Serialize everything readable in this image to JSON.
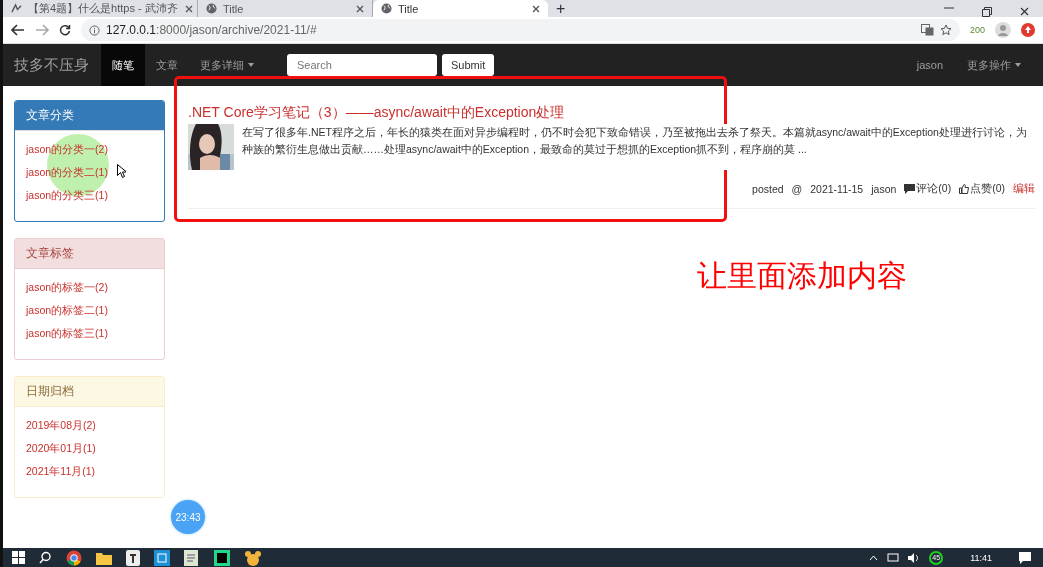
{
  "browser": {
    "tabs": [
      {
        "title": "【第4题】什么是https - 武沛齐",
        "selected": false
      },
      {
        "title": "Title",
        "selected": false
      },
      {
        "title": "Title",
        "selected": true
      }
    ],
    "new_tab": "+",
    "url_host": "127.0.0.1",
    "url_rest": ":8000/jason/archive/2021-11/#",
    "extension_badge": "200"
  },
  "navbar": {
    "brand": "技多不压身",
    "items": [
      {
        "label": "随笔",
        "selected": true,
        "dropdown": false
      },
      {
        "label": "文章",
        "selected": false,
        "dropdown": false
      },
      {
        "label": "更多详细",
        "selected": false,
        "dropdown": true
      }
    ],
    "search": {
      "placeholder": "Search"
    },
    "submit": "Submit",
    "user": "jason",
    "more": "更多操作"
  },
  "sidebar": [
    {
      "kind": "primary",
      "title": "文章分类",
      "items": [
        "jason的分类一(2)",
        "jason的分类二(1)",
        "jason的分类三(1)"
      ]
    },
    {
      "kind": "danger",
      "title": "文章标签",
      "items": [
        "jason的标签一(2)",
        "jason的标签二(1)",
        "jason的标签三(1)"
      ]
    },
    {
      "kind": "warning",
      "title": "日期归档",
      "items": [
        "2019年08月(2)",
        "2020年01月(1)",
        "2021年11月(1)"
      ]
    }
  ],
  "articles": [
    {
      "title": ".NET Core学习笔记（3）——async/await中的Exception处理",
      "summary": "在写了很多年.NET程序之后，年长的猿类在面对异步编程时，仍不时会犯下致命错误，乃至被拖出去杀了祭天。本篇就async/await中的Exception处理进行讨论，为种族的繁衍生息做出贡献……处理async/await中的Exception，最致命的莫过于想抓的Exception抓不到，程序崩的莫 ...",
      "posted": "posted",
      "at": "@",
      "date": "2021-11-15",
      "author": "jason",
      "comments": "评论(0)",
      "likes": "点赞(0)",
      "edit": "编辑"
    }
  ],
  "annotation": {
    "text": "让里面添加内容"
  },
  "timer": "23:43",
  "taskbar": {
    "tray_badge": "45",
    "time": "11:41"
  }
}
